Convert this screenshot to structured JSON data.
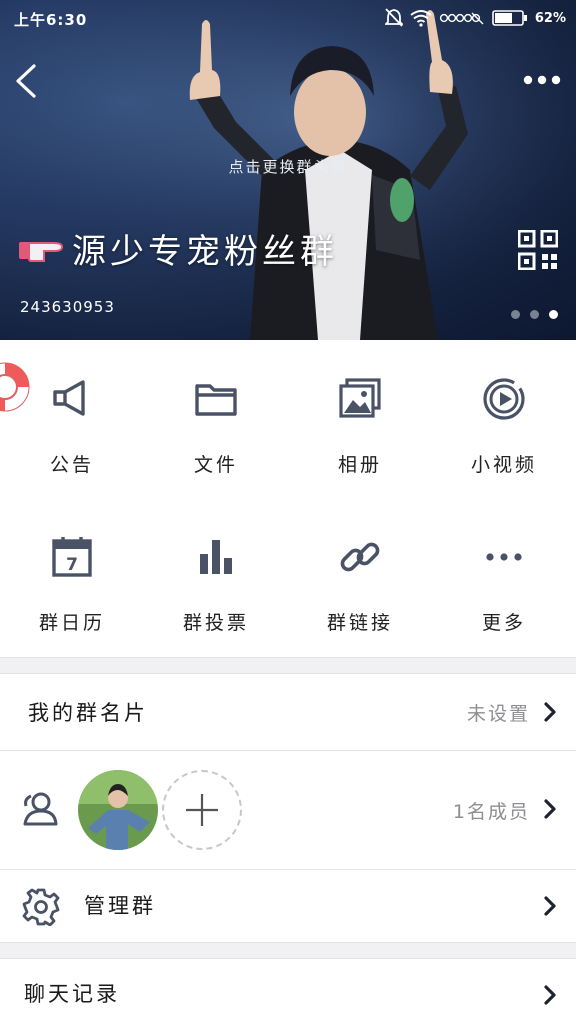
{
  "status_bar": {
    "time": "上午6:30",
    "battery": "62%"
  },
  "header": {
    "change_avatar_hint": "点击更换群头像",
    "group_name": "源少专宠粉丝群",
    "group_id": "243630953",
    "pager": {
      "count": 3,
      "active_index": 2
    }
  },
  "features": [
    {
      "label": "公告",
      "icon": "megaphone-icon"
    },
    {
      "label": "文件",
      "icon": "folder-icon"
    },
    {
      "label": "相册",
      "icon": "photo-album-icon"
    },
    {
      "label": "小视频",
      "icon": "video-play-icon"
    },
    {
      "label": "群日历",
      "icon": "calendar-icon",
      "calendar_day": "7"
    },
    {
      "label": "群投票",
      "icon": "bar-chart-icon"
    },
    {
      "label": "群链接",
      "icon": "link-icon"
    },
    {
      "label": "更多",
      "icon": "more-dots-icon"
    }
  ],
  "rows": {
    "card": {
      "title": "我的群名片",
      "value": "未设置"
    },
    "members": {
      "value": "1名成员"
    },
    "manage": {
      "title": "管理群"
    },
    "history": {
      "title": "聊天记录"
    }
  },
  "colors": {
    "icon": "#4a5266",
    "accent": "#f05a5a",
    "divider": "#f1f1f4"
  }
}
